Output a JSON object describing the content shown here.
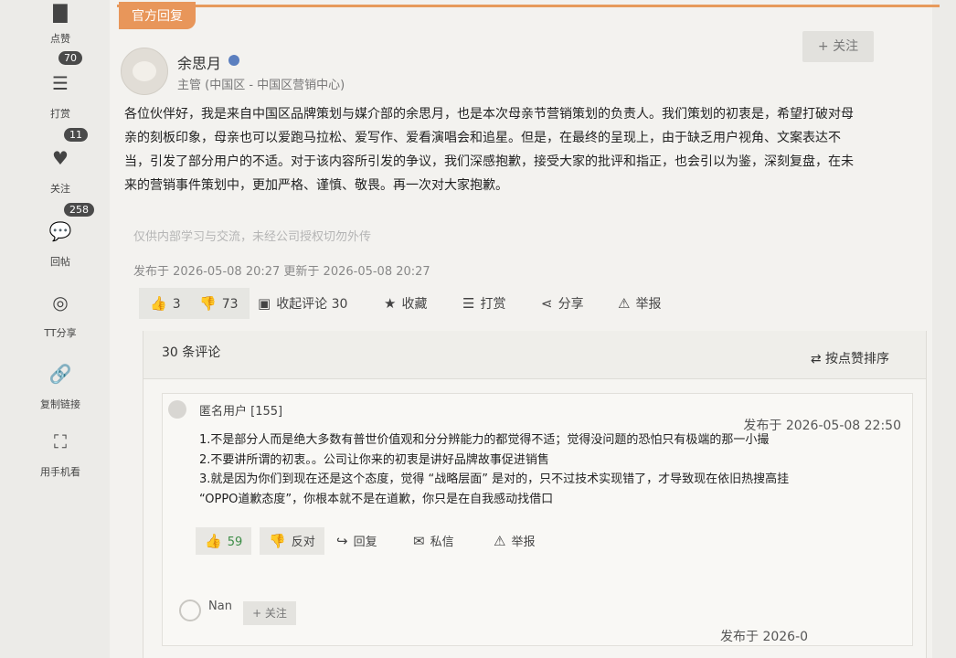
{
  "sidebar": {
    "items": [
      {
        "label": "点赞",
        "badge": "70",
        "icon": "thumb-icon"
      },
      {
        "label": "打赏",
        "badge": "11",
        "icon": "coin-icon"
      },
      {
        "label": "关注",
        "badge": "258",
        "icon": "heart-icon"
      },
      {
        "label": "回帖",
        "icon": "comment-icon"
      },
      {
        "label": "TT分享",
        "icon": "share-circle-icon"
      },
      {
        "label": "复制链接",
        "icon": "link-icon"
      },
      {
        "label": "用手机看",
        "icon": "scan-icon"
      }
    ]
  },
  "post": {
    "tag": "官方回复",
    "author": "余思月",
    "role": "主管 (中国区 - 中国区营销中心)",
    "follow_label": "+ 关注",
    "body": [
      "各位伙伴好，我是来自中国区品牌策划与媒介部的余思月，也是本次母亲节营销策划的负责人。我们策划的初衷是，希望打破对母",
      "亲的刻板印象，母亲也可以爱跑马拉松、爱写作、爱看演唱会和追星。但是，在最终的呈现上，由于缺乏用户视角、文案表达不",
      "当，引发了部分用户的不适。对于该内容所引发的争议，我们深感抱歉，接受大家的批评和指正，也会引以为鉴，深刻复盘，在未",
      "来的营销事件策划中，更加严格、谨慎、敬畏。再一次对大家抱歉。"
    ],
    "disclaimer": "仅供内部学习与交流，未经公司授权切勿外传",
    "meta": "发布于 2026-05-08 20:27 更新于 2026-05-08 20:27",
    "actions": {
      "like_count": "3",
      "dislike_count": "73",
      "collapse_comments": "收起评论 30",
      "favorite": "收藏",
      "tip": "打赏",
      "share": "分享",
      "report": "举报"
    }
  },
  "comments": {
    "count_label": "30 条评论",
    "sort_label": "按点赞排序",
    "items": [
      {
        "user": "匿名用户 [155]",
        "date": "发布于 2026-05-08 22:50",
        "lines": [
          "1.不是部分人而是绝大多数有普世价值观和分分辨能力的都觉得不适；觉得没问题的恐怕只有极端的那一小撮",
          "2.不要讲所谓的初衷。。公司让你来的初衷是讲好品牌故事促进销售",
          "3.就是因为你们到现在还是这个态度，觉得 “战略层面” 是对的，只不过技术实现错了，才导致现在依旧热搜高挂",
          "“OPPO道歉态度”，你根本就不是在道歉，你只是在自我感动找借口"
        ],
        "like_count": "59",
        "dislike_label": "反对",
        "reply_label": "回复",
        "message_label": "私信",
        "report_label": "举报"
      }
    ],
    "next": {
      "user": "Nan",
      "follow_label": "+ 关注",
      "date": "发布于 2026-0"
    }
  }
}
